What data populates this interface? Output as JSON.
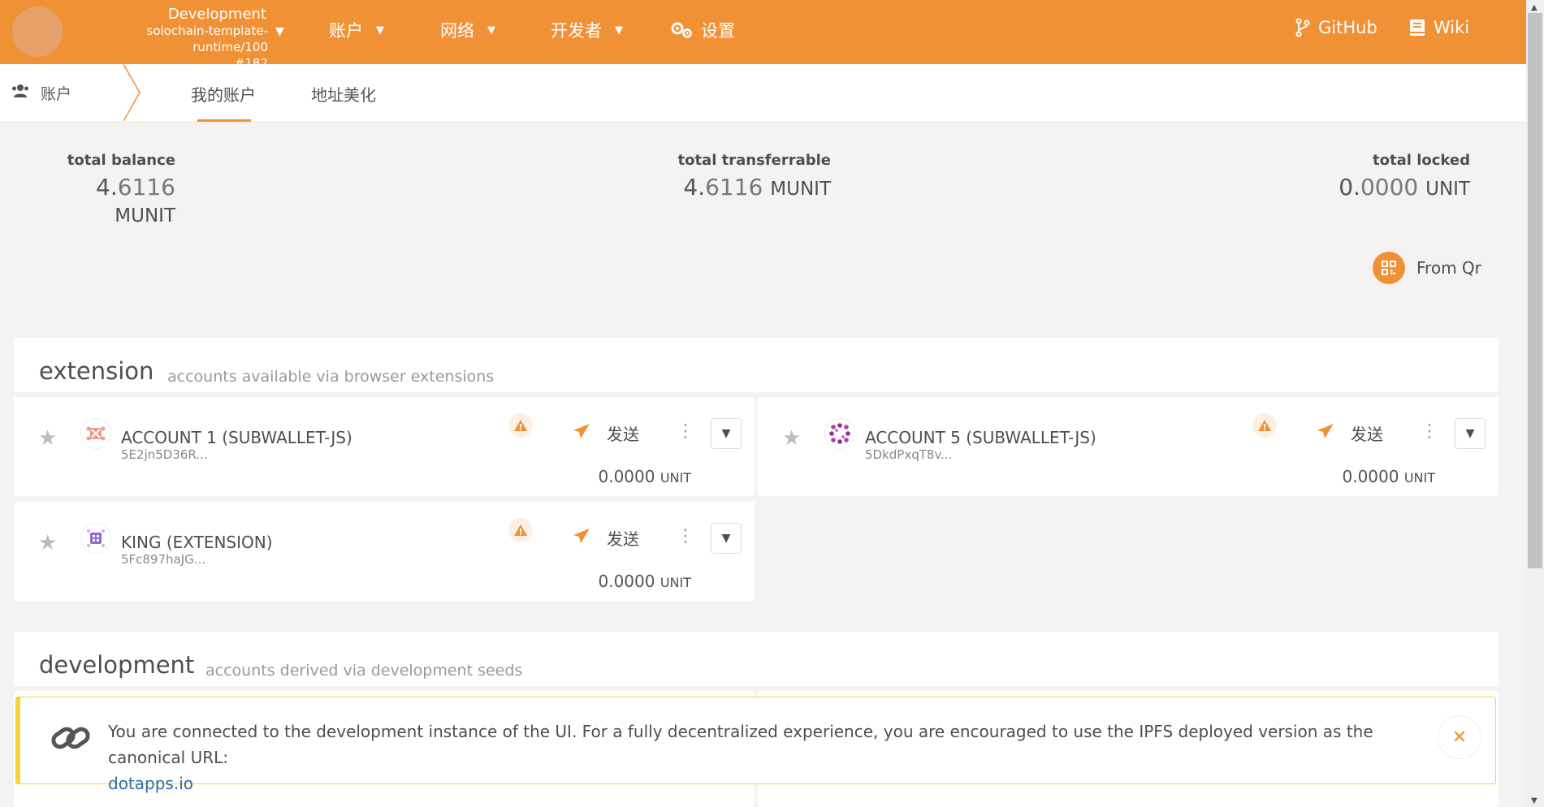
{
  "topbar": {
    "chain_name": "Development",
    "chain_runtime": "solochain-template-runtime/100",
    "chain_block": "#182",
    "nav": {
      "accounts": "账户",
      "network": "网络",
      "developer": "开发者",
      "settings": "设置",
      "github": "GitHub",
      "wiki": "Wiki"
    }
  },
  "subheader": {
    "section": "账户",
    "tabs": [
      "我的账户",
      "地址美化"
    ]
  },
  "summary": {
    "total_balance": {
      "label": "total balance",
      "int": "4.",
      "dec": "6116",
      "unit": "MUNIT"
    },
    "total_transferrable": {
      "label": "total transferrable",
      "int": "4.",
      "dec": "6116",
      "unit": "MUNIT"
    },
    "total_locked": {
      "label": "total locked",
      "int": "0.",
      "dec": "0000",
      "unit": "UNIT"
    }
  },
  "from_qr": "From Qr",
  "sections": {
    "extension": {
      "title": "extension",
      "subtitle": "accounts available via browser extensions"
    },
    "development": {
      "title": "development",
      "subtitle": "accounts derived via development seeds"
    }
  },
  "accounts": [
    {
      "name": "ACCOUNT 1 (SUBWALLET-JS)",
      "address": "5E2jn5D36R...",
      "send": "发送",
      "balance_int": "0.",
      "balance_dec": "0000",
      "unit": "UNIT"
    },
    {
      "name": "ACCOUNT 5 (SUBWALLET-JS)",
      "address": "5DkdPxqT8v...",
      "send": "发送",
      "balance_int": "0.",
      "balance_dec": "0000",
      "unit": "UNIT"
    },
    {
      "name": "KING (EXTENSION)",
      "address": "5Fc897haJG...",
      "send": "发送",
      "balance_int": "0.",
      "balance_dec": "0000",
      "unit": "UNIT"
    }
  ],
  "notice": {
    "message": "You are connected to the development instance of the UI. For a fully decentralized experience, you are encouraged to use the IPFS deployed version as the canonical URL:",
    "link": "dotapps.io"
  },
  "colors": {
    "accent": "#f19135",
    "background": "#f4f3f2",
    "notice_border": "#f5d33b",
    "link": "#2d6da3"
  },
  "icons": {
    "settings": "gears-icon",
    "github": "code-branch-icon",
    "wiki": "book-icon",
    "section": "users-icon",
    "qr": "qrcode-icon",
    "star": "star-icon",
    "warn": "warning-icon",
    "send": "paper-plane-icon",
    "more": "ellipsis-vertical-icon",
    "expand": "caret-down-icon",
    "notice": "link-icon",
    "close": "close-icon"
  }
}
